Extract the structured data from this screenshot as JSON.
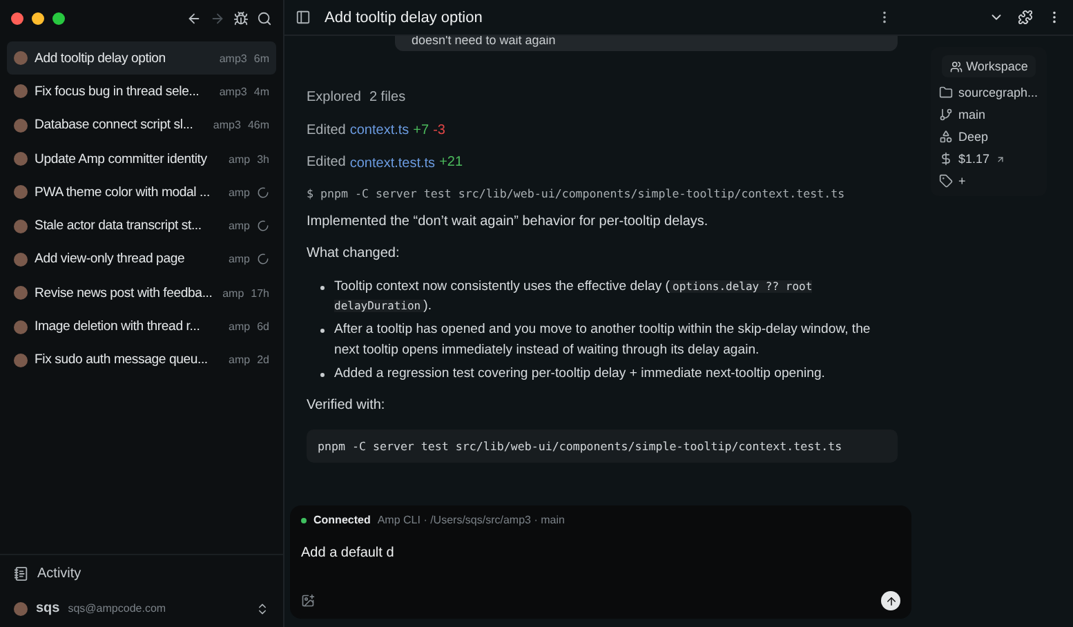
{
  "sidebar": {
    "nav": {
      "back_disabled": false,
      "forward_disabled": true
    },
    "threads": [
      {
        "title": "Add tooltip delay option",
        "workspace": "amp3",
        "time": "6m",
        "running": false,
        "selected": true
      },
      {
        "title": "Fix focus bug in thread sele...",
        "workspace": "amp3",
        "time": "4m",
        "running": false,
        "selected": false
      },
      {
        "title": "Database connect script sl...",
        "workspace": "amp3",
        "time": "46m",
        "running": false,
        "selected": false
      },
      {
        "title": "Update Amp committer identity",
        "workspace": "amp",
        "time": "3h",
        "running": false,
        "selected": false
      },
      {
        "title": "PWA theme color with modal ...",
        "workspace": "amp",
        "running": true,
        "selected": false
      },
      {
        "title": "Stale actor data transcript st...",
        "workspace": "amp",
        "running": true,
        "selected": false
      },
      {
        "title": "Add view-only thread page",
        "workspace": "amp",
        "running": true,
        "selected": false
      },
      {
        "title": "Revise news post with feedba...",
        "workspace": "amp",
        "time": "17h",
        "running": false,
        "selected": false
      },
      {
        "title": "Image deletion with thread r...",
        "workspace": "amp",
        "time": "6d",
        "running": false,
        "selected": false
      },
      {
        "title": "Fix sudo auth message queu...",
        "workspace": "amp",
        "time": "2d",
        "running": false,
        "selected": false
      }
    ],
    "activity": "Activity",
    "user": {
      "name": "sqs",
      "email": "sqs@ampcode.com"
    }
  },
  "thread": {
    "title": "Add tooltip delay option",
    "user_message": "doesn't need to wait again",
    "explored": {
      "label": "Explored",
      "count": "2 files"
    },
    "edits": [
      {
        "label": "Edited",
        "file": "context.ts",
        "added": "+7",
        "removed": "-3"
      },
      {
        "label": "Edited",
        "file": "context.test.ts",
        "added": "+21"
      }
    ],
    "command": "$ pnpm -C server test src/lib/web-ui/components/simple-tooltip/context.test.ts",
    "summary": "Implemented the “don’t wait again” behavior for per-tooltip delays.",
    "changes_heading": "What changed:",
    "bullets": [
      [
        {
          "text": "Tooltip context now consistently uses the effective delay (",
          "code": false
        },
        {
          "text": "options.delay ?? root delayDuration",
          "code": true
        },
        {
          "text": ").",
          "code": false
        }
      ],
      [
        {
          "text": "After a tooltip has opened and you move to another tooltip within the skip-delay window, the next tooltip opens immediately instead of waiting through its delay again.",
          "code": false
        }
      ],
      [
        {
          "text": "Added a regression test covering per-tooltip delay + immediate next-tooltip opening.",
          "code": false
        }
      ]
    ],
    "verified_heading": "Verified with:",
    "verified_command": "pnpm -C server test src/lib/web-ui/components/simple-tooltip/context.test.ts"
  },
  "composer": {
    "connected": true,
    "status": "Connected",
    "context": "Amp CLI · /Users/sqs/src/amp3 · main",
    "value": "Add a default d"
  },
  "workspace_panel": {
    "button": "Workspace",
    "rows": [
      {
        "kind": "folder",
        "text": "sourcegraph..."
      },
      {
        "kind": "branch",
        "text": "main"
      },
      {
        "kind": "mode",
        "text": "Deep"
      },
      {
        "kind": "cost",
        "text": "$1.17"
      },
      {
        "kind": "tags",
        "text": "+"
      }
    ]
  }
}
